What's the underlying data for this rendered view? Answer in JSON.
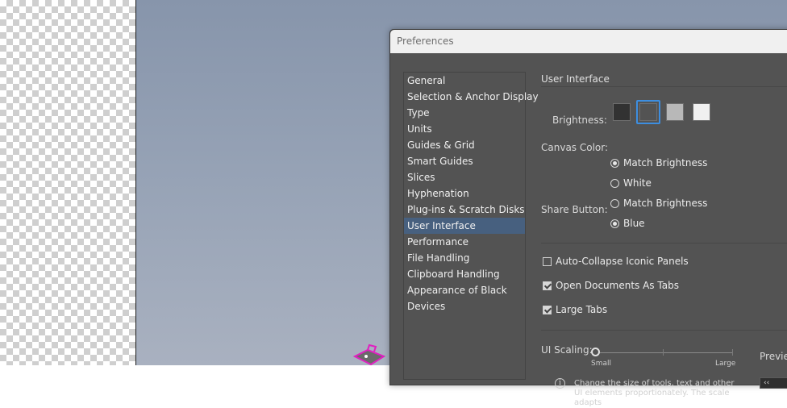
{
  "dialog": {
    "title": "Preferences"
  },
  "sidebar": {
    "items": [
      {
        "label": "General"
      },
      {
        "label": "Selection & Anchor Display"
      },
      {
        "label": "Type"
      },
      {
        "label": "Units"
      },
      {
        "label": "Guides & Grid"
      },
      {
        "label": "Smart Guides"
      },
      {
        "label": "Slices"
      },
      {
        "label": "Hyphenation"
      },
      {
        "label": "Plug-ins & Scratch Disks"
      },
      {
        "label": "User Interface",
        "selected": true
      },
      {
        "label": "Performance"
      },
      {
        "label": "File Handling"
      },
      {
        "label": "Clipboard Handling"
      },
      {
        "label": "Appearance of Black"
      },
      {
        "label": "Devices"
      }
    ]
  },
  "ui": {
    "section_title": "User Interface",
    "brightness": {
      "label": "Brightness:",
      "swatches": [
        "#323232",
        "#535353",
        "#b8b8b8",
        "#f0f0f0"
      ],
      "selected_index": 1
    },
    "canvas_color": {
      "label": "Canvas Color:",
      "options": [
        "Match Brightness",
        "White"
      ],
      "selected": "Match Brightness"
    },
    "share_button": {
      "label": "Share Button:",
      "options": [
        "Match Brightness",
        "Blue"
      ],
      "selected": "Blue"
    },
    "checkboxes": [
      {
        "label": "Auto-Collapse Iconic Panels",
        "checked": false
      },
      {
        "label": "Open Documents As Tabs",
        "checked": true
      },
      {
        "label": "Large Tabs",
        "checked": true
      }
    ],
    "scaling": {
      "label": "UI Scaling:",
      "min_label": "Small",
      "max_label": "Large",
      "info": "Change the size of tools, text and other UI elements proportionately. The scale adapts"
    },
    "preview": {
      "label": "Previe",
      "box_text": "‹‹"
    }
  },
  "colors": {
    "dialog_bg": "#535353",
    "selection": "#47607f",
    "accent": "#3d8ee0"
  }
}
